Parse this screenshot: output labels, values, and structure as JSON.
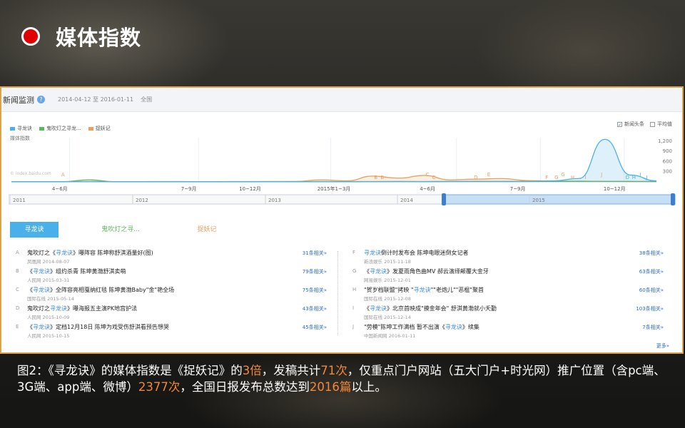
{
  "slide": {
    "title": "媒体指数"
  },
  "panel": {
    "title": "新闻监测",
    "help_icon": "?",
    "date_range": "2014-04-12 至 2016-01-11",
    "region": "全国",
    "legend": [
      {
        "label": "寻龙诀",
        "color": "#49b0ea"
      },
      {
        "label": "鬼吹灯之寻龙...",
        "color": "#5cb85c"
      },
      {
        "label": "捉妖记",
        "color": "#e8a060"
      }
    ],
    "options": [
      {
        "label": "新闻头条",
        "checked": true,
        "mark": "✓"
      },
      {
        "label": "平均值",
        "checked": false,
        "mark": ""
      }
    ],
    "y_axis_label": "媒体指数",
    "watermark": "© index.baidu.com"
  },
  "chart_data": {
    "type": "line",
    "y_ticks": [
      "1,200",
      "900",
      "600",
      "300"
    ],
    "ylim": [
      0,
      1300
    ],
    "x_ticks": [
      "4~6月",
      "7~9月",
      "10~12月",
      "2015年1~3月",
      "4~6月",
      "7~9月",
      "10~12月"
    ],
    "markers": [
      "A",
      "B",
      "B",
      "C",
      "C",
      "D",
      "E",
      "F",
      "G",
      "G",
      "H",
      "I",
      "J",
      "D",
      "H",
      "I",
      "J"
    ],
    "series": [
      {
        "name": "寻龙诀",
        "color": "#49b0ea",
        "values": [
          8,
          8,
          8,
          10,
          8,
          8,
          10,
          8,
          8,
          10,
          8,
          10,
          12,
          10,
          10,
          12,
          10,
          14,
          18,
          14,
          16,
          30,
          100,
          1250,
          200,
          30
        ]
      },
      {
        "name": "鬼吹灯之寻龙...",
        "color": "#5cb85c",
        "values": [
          5,
          6,
          5,
          60,
          6,
          5,
          6,
          5,
          6,
          5,
          10,
          6,
          8,
          6,
          8,
          10,
          8,
          10,
          12,
          10,
          12,
          14,
          20,
          16,
          14,
          12
        ]
      },
      {
        "name": "捉妖记",
        "color": "#e8a060",
        "values": [
          5,
          5,
          5,
          6,
          5,
          5,
          6,
          5,
          6,
          6,
          10,
          12,
          60,
          30,
          170,
          110,
          190,
          60,
          80,
          100,
          40,
          25,
          20,
          15,
          12,
          10
        ]
      }
    ]
  },
  "timeline": {
    "years": [
      "2011",
      "2012",
      "2013",
      "2014",
      "2015"
    ]
  },
  "tabs": [
    {
      "label": "寻龙诀",
      "active": true,
      "color": "#ffffff"
    },
    {
      "label": "鬼吹灯之寻...",
      "active": false,
      "color": "#5cb85c"
    },
    {
      "label": "捉妖记",
      "active": false,
      "color": "#e8a060"
    }
  ],
  "news": {
    "left": [
      {
        "letter": "A",
        "pre": "鬼吹灯之《",
        "hl": "寻龙诀",
        "post": "》曝阵容 陈坤称舒淇酒量好(图)",
        "source": "凤凰网 2014-08-07",
        "related": "31条相关»"
      },
      {
        "letter": "B",
        "pre": "《",
        "hl": "寻龙诀",
        "post": "》组约杀青 陈坤黄渤舒淇卖萌",
        "source": "人民网 2015-03-31",
        "related": "79条相关»"
      },
      {
        "letter": "C",
        "pre": "《",
        "hl": "寻龙诀",
        "post": "》全阵容亮相戛纳红毯 陈坤黄渤Baby\"金\"艳全场",
        "source": "国际在线 2015-05-14",
        "related": "75条相关»"
      },
      {
        "letter": "D",
        "pre": "鬼吹灯之",
        "hl": "寻龙诀",
        "post": "》曝海报五主演PK地宫护法",
        "source": "人民网 2015-10-09",
        "related": "43条相关»"
      },
      {
        "letter": "E",
        "pre": "《",
        "hl": "寻龙诀",
        "post": "》定档12月18日 陈坤为戏受伤舒淇看预告想哭",
        "source": "人民网 2015-10-15",
        "related": "45条相关»"
      }
    ],
    "right": [
      {
        "letter": "F",
        "pre": "",
        "hl": "寻龙诀",
        "post": "倒计时发布会 陈坤电眼迷倒女记者",
        "source": "新浪娱乐 2015-11-18",
        "related": "38条相关»"
      },
      {
        "letter": "G",
        "pre": "《",
        "hl": "寻龙诀",
        "post": "》发夏雨角色曲MV 郝云演绎颠覆大金牙",
        "source": "网易娱乐 2015-12-01",
        "related": "63条相关»"
      },
      {
        "letter": "H",
        "pre": "\"贺岁档联盟\"拷映 \"",
        "hl": "寻龙诀",
        "post": "\"\"老炮儿\"\"恶棍\"聚首",
        "source": "国际在线 2015-12-08",
        "related": "60条相关»"
      },
      {
        "letter": "I",
        "pre": "《",
        "hl": "寻龙诀",
        "post": "》北京首映成\"摸金年会\" 舒淇黄渤就小夭勤",
        "source": "国际在线 2015-12-14",
        "related": "103条相关»"
      },
      {
        "letter": "J",
        "pre": "\"劳模\"陈坤工作满档 暂不出演《",
        "hl": "寻龙诀",
        "post": "》续集",
        "source": "中国新闻网 2016-01-11",
        "related": "7条相关»"
      }
    ],
    "more": "更多»"
  },
  "caption": {
    "p1": "图2：《寻龙诀》的媒体指数是《捉妖记》的",
    "n1": "3倍",
    "p2": "，发稿共计",
    "n2": "71次",
    "p3": "，仅重点门户网站（五大门户+时光网）推广位置（含pc端、3G端、app端、微博）",
    "n3": "2377次",
    "p4": "，全国日报发布总数达到",
    "n4": "2016篇",
    "p5": "以上。"
  }
}
